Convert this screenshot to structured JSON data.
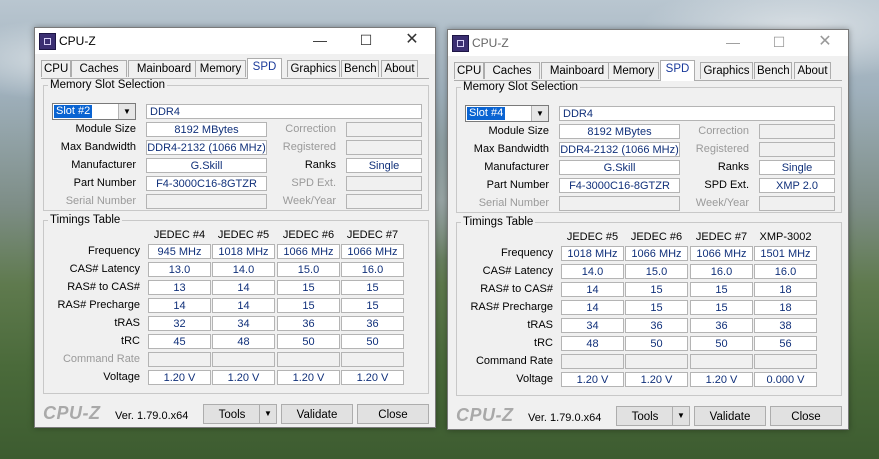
{
  "windows": [
    {
      "title": "CPU-Z",
      "tabs": [
        "CPU",
        "Caches",
        "Mainboard",
        "Memory",
        "SPD",
        "Graphics",
        "Bench",
        "About"
      ],
      "active_tab": "SPD",
      "slot_group_label": "Memory Slot Selection",
      "slot": "Slot #2",
      "ddr": "DDR4",
      "module_size_label": "Module Size",
      "module_size": "8192 MBytes",
      "max_bw_label": "Max Bandwidth",
      "max_bw": "DDR4-2132 (1066 MHz)",
      "manufacturer_label": "Manufacturer",
      "manufacturer": "G.Skill",
      "part_label": "Part Number",
      "part": "F4-3000C16-8GTZR",
      "serial_label": "Serial Number",
      "serial": "",
      "correction_label": "Correction",
      "correction": "",
      "registered_label": "Registered",
      "registered": "",
      "ranks_label": "Ranks",
      "ranks": "Single",
      "spd_ext_label": "SPD Ext.",
      "spd_ext": "",
      "week_label": "Week/Year",
      "week": "",
      "spd_ext_dim": true,
      "timings_label": "Timings Table",
      "columns": [
        "JEDEC #4",
        "JEDEC #5",
        "JEDEC #6",
        "JEDEC #7"
      ],
      "rows": [
        {
          "label": "Frequency",
          "values": [
            "945 MHz",
            "1018 MHz",
            "1066 MHz",
            "1066 MHz"
          ]
        },
        {
          "label": "CAS# Latency",
          "values": [
            "13.0",
            "14.0",
            "15.0",
            "16.0"
          ]
        },
        {
          "label": "RAS# to CAS#",
          "values": [
            "13",
            "14",
            "15",
            "15"
          ]
        },
        {
          "label": "RAS# Precharge",
          "values": [
            "14",
            "14",
            "15",
            "15"
          ]
        },
        {
          "label": "tRAS",
          "values": [
            "32",
            "34",
            "36",
            "36"
          ]
        },
        {
          "label": "tRC",
          "values": [
            "45",
            "48",
            "50",
            "50"
          ]
        },
        {
          "label": "Command Rate",
          "values": [
            "",
            "",
            "",
            ""
          ],
          "dim": true
        },
        {
          "label": "Voltage",
          "values": [
            "1.20 V",
            "1.20 V",
            "1.20 V",
            "1.20 V"
          ]
        }
      ],
      "logo": "CPU-Z",
      "version": "Ver. 1.79.0.x64",
      "tools": "Tools",
      "validate": "Validate",
      "close": "Close"
    },
    {
      "title": "CPU-Z",
      "tabs": [
        "CPU",
        "Caches",
        "Mainboard",
        "Memory",
        "SPD",
        "Graphics",
        "Bench",
        "About"
      ],
      "active_tab": "SPD",
      "slot_group_label": "Memory Slot Selection",
      "slot": "Slot #4",
      "ddr": "DDR4",
      "module_size_label": "Module Size",
      "module_size": "8192 MBytes",
      "max_bw_label": "Max Bandwidth",
      "max_bw": "DDR4-2132 (1066 MHz)",
      "manufacturer_label": "Manufacturer",
      "manufacturer": "G.Skill",
      "part_label": "Part Number",
      "part": "F4-3000C16-8GTZR",
      "serial_label": "Serial Number",
      "serial": "",
      "correction_label": "Correction",
      "correction": "",
      "registered_label": "Registered",
      "registered": "",
      "ranks_label": "Ranks",
      "ranks": "Single",
      "spd_ext_label": "SPD Ext.",
      "spd_ext": "XMP 2.0",
      "week_label": "Week/Year",
      "week": "",
      "spd_ext_dim": false,
      "timings_label": "Timings Table",
      "columns": [
        "JEDEC #5",
        "JEDEC #6",
        "JEDEC #7",
        "XMP-3002"
      ],
      "rows": [
        {
          "label": "Frequency",
          "values": [
            "1018 MHz",
            "1066 MHz",
            "1066 MHz",
            "1501 MHz"
          ]
        },
        {
          "label": "CAS# Latency",
          "values": [
            "14.0",
            "15.0",
            "16.0",
            "16.0"
          ]
        },
        {
          "label": "RAS# to CAS#",
          "values": [
            "14",
            "15",
            "15",
            "18"
          ]
        },
        {
          "label": "RAS# Precharge",
          "values": [
            "14",
            "15",
            "15",
            "18"
          ]
        },
        {
          "label": "tRAS",
          "values": [
            "34",
            "36",
            "36",
            "38"
          ]
        },
        {
          "label": "tRC",
          "values": [
            "48",
            "50",
            "50",
            "56"
          ]
        },
        {
          "label": "Command Rate",
          "values": [
            "",
            "",
            "",
            ""
          ],
          "dim": false
        },
        {
          "label": "Voltage",
          "values": [
            "1.20 V",
            "1.20 V",
            "1.20 V",
            "0.000 V"
          ]
        }
      ],
      "logo": "CPU-Z",
      "version": "Ver. 1.79.0.x64",
      "tools": "Tools",
      "validate": "Validate",
      "close": "Close"
    }
  ]
}
